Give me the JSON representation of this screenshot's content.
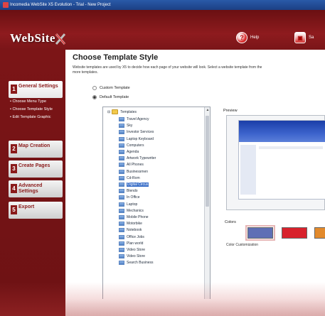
{
  "titlebar": {
    "title": "Incomedia WebSite X5 Evolution - Trial - New Project"
  },
  "header": {
    "logo_text": "WebSite",
    "help_label": "Help",
    "save_label": "Sa"
  },
  "sidebar": {
    "steps": [
      {
        "num": "1",
        "label": "General Settings"
      },
      {
        "num": "2",
        "label": "Map Creation"
      },
      {
        "num": "3",
        "label": "Create Pages"
      },
      {
        "num": "4",
        "label": "Advanced Settings"
      },
      {
        "num": "5",
        "label": "Export"
      }
    ],
    "sub_items": [
      "• Choose Menu Type",
      "• Choose Template Style",
      "• Edit Template Graphic"
    ]
  },
  "main": {
    "title": "Choose Template Style",
    "description_line1": "Website templates are used by X5 to decide how each page of your website will look. Select a website template from the",
    "description_line2": "more templates.",
    "radio_custom": "Custom Template",
    "radio_default": "Default Template",
    "tree_root": "Templates",
    "tree_items": [
      "Travel Agency",
      "Sky",
      "Investor Services",
      "Laptop Keyboard",
      "Computers",
      "Agenda",
      "Artwork Typewriter",
      "All Phones",
      "Businessmen",
      "Cd-Rom",
      "Digital Circus",
      "Blendo",
      "In Office",
      "Laptop",
      "Mechanics",
      "Mobile Phone",
      "Motorbike",
      "Notebook",
      "Office Jobs",
      "Plan world",
      "Video Store",
      "Video Store",
      "Search Business"
    ],
    "selected_index": 10,
    "preview_label": "Preview",
    "colors_label": "Colors",
    "color_customization_label": "Color Customization",
    "swatches": [
      "#5f6fb5",
      "#d8222c",
      "#e28a2c"
    ]
  }
}
